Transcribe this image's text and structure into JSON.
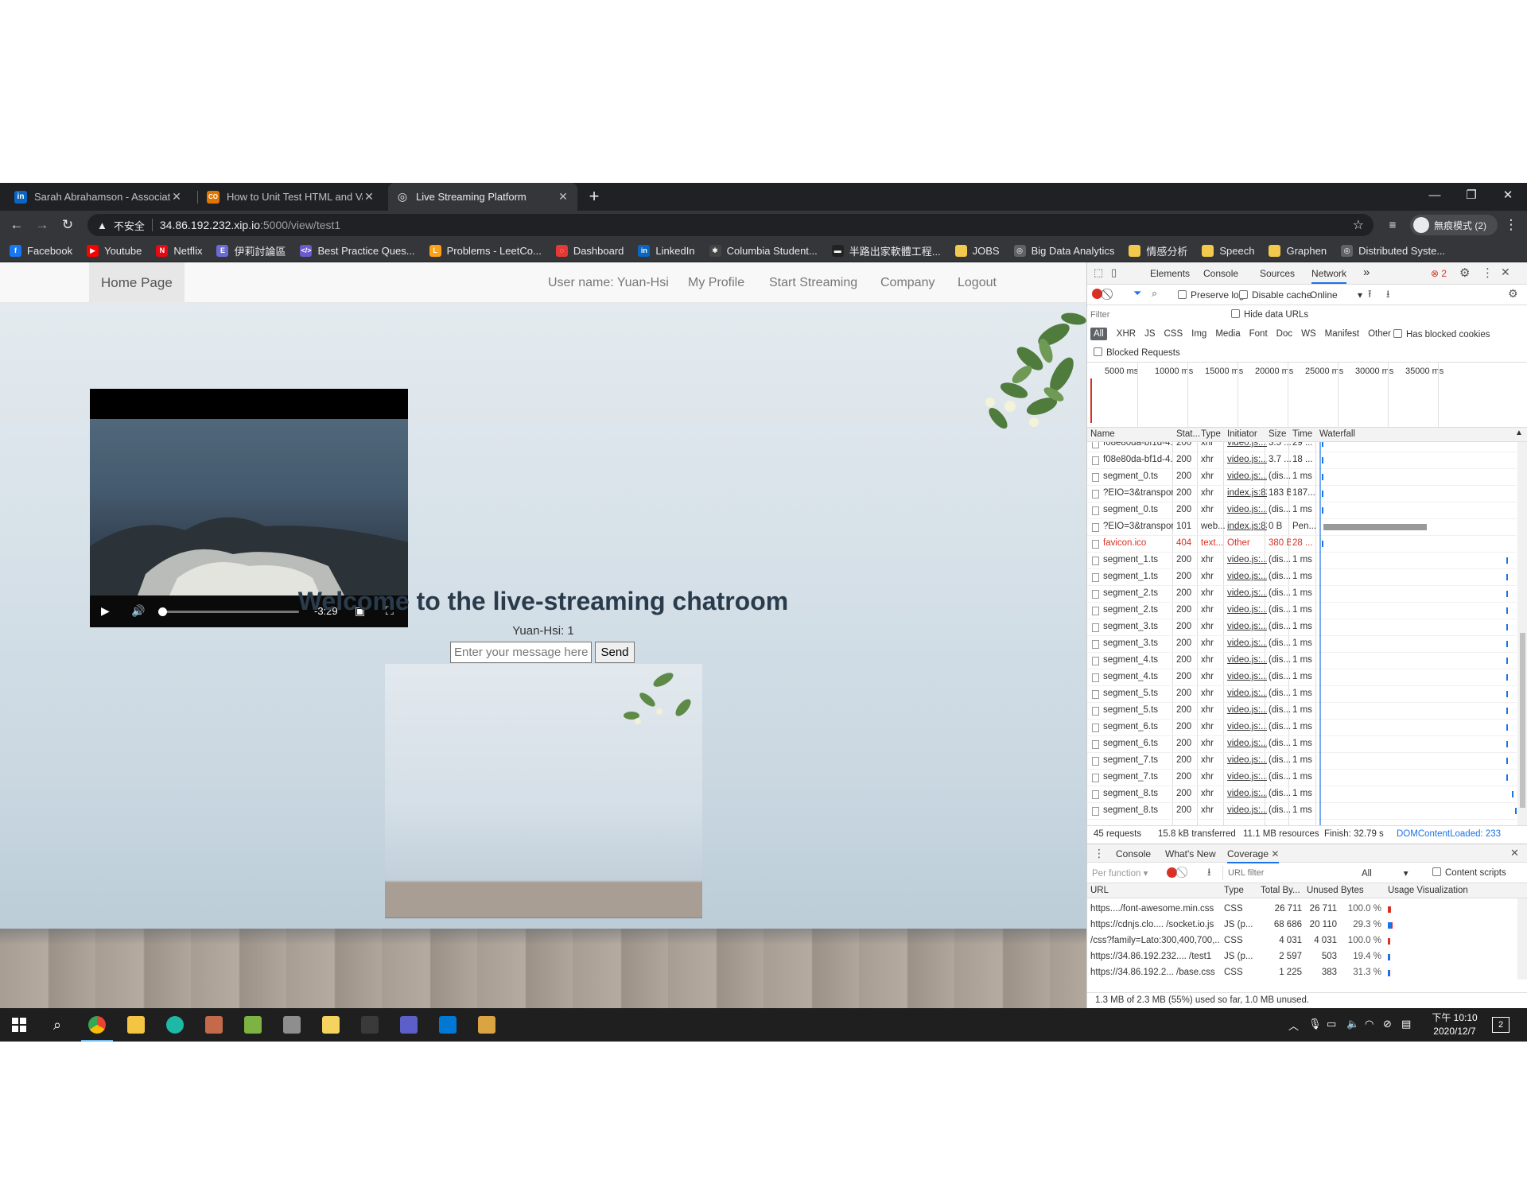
{
  "browser": {
    "tabs": [
      {
        "title": "Sarah Abrahamson - Associate",
        "icon": "linkedin-icon",
        "color": "#0a66c2",
        "glyph": "in"
      },
      {
        "title": "How to Unit Test HTML and Va",
        "icon": "colab-icon",
        "color": "#f9ab00",
        "glyph": "CO"
      },
      {
        "title": "Live Streaming Platform",
        "icon": "globe-icon",
        "color": "#5f6368",
        "glyph": "◎"
      }
    ],
    "new_tab": "+",
    "window_controls": {
      "minimize": "—",
      "maximize": "❐",
      "close": "✕"
    },
    "insecure_label": "不安全",
    "url_host": "34.86.192.232.xip.io",
    "url_path": ":5000/view/test1",
    "profile_label": "無痕模式 (2)"
  },
  "bookmarks": [
    {
      "label": "Facebook",
      "color": "#1877f2",
      "glyph": "f"
    },
    {
      "label": "Youtube",
      "color": "#ff0000",
      "glyph": "▶"
    },
    {
      "label": "Netflix",
      "color": "#e50914",
      "glyph": "N"
    },
    {
      "label": "伊莉討論區",
      "color": "#6b6bd6",
      "glyph": "E"
    },
    {
      "label": "Best Practice Ques...",
      "color": "#6a5acd",
      "glyph": "</>"
    },
    {
      "label": "Problems - LeetCo...",
      "color": "#ffa116",
      "glyph": "L"
    },
    {
      "label": "Dashboard",
      "color": "#e53935",
      "glyph": "◌"
    },
    {
      "label": "LinkedIn",
      "color": "#0a66c2",
      "glyph": "in"
    },
    {
      "label": "Columbia Student...",
      "color": "#444444",
      "glyph": "✱"
    },
    {
      "label": "半路出家軟體工程...",
      "color": "#222222",
      "glyph": "▬"
    },
    {
      "label": "JOBS",
      "color": "#f2c94c",
      "glyph": ""
    },
    {
      "label": "Big Data Analytics",
      "color": "#5f6368",
      "glyph": "◎"
    },
    {
      "label": "情感分析",
      "color": "#f2c94c",
      "glyph": ""
    },
    {
      "label": "Speech",
      "color": "#f2c94c",
      "glyph": ""
    },
    {
      "label": "Graphen",
      "color": "#f2c94c",
      "glyph": ""
    },
    {
      "label": "Distributed Syste...",
      "color": "#5f6368",
      "glyph": "◎"
    }
  ],
  "site": {
    "brand": "Home Page",
    "nav": [
      "User name: Yuan-Hsi",
      "My Profile",
      "Start Streaming",
      "Company",
      "Logout"
    ],
    "video_time": "-3:29",
    "video_progress": 0.0,
    "heading": "Welcome to the live-streaming chatroom",
    "chat_message": "Yuan-Hsi: 1",
    "input_placeholder": "Enter your message here",
    "send_label": "Send"
  },
  "devtools": {
    "tabs": [
      "Elements",
      "Console",
      "Sources",
      "Network"
    ],
    "more": "»",
    "error_count": "2",
    "preserve_log": "Preserve log",
    "disable_cache": "Disable cache",
    "throttle": "Online",
    "filter_placeholder": "Filter",
    "hide_data_urls": "Hide data URLs",
    "types": [
      "All",
      "XHR",
      "JS",
      "CSS",
      "Img",
      "Media",
      "Font",
      "Doc",
      "WS",
      "Manifest",
      "Other"
    ],
    "has_blocked_cookies": "Has blocked cookies",
    "blocked_requests": "Blocked Requests",
    "timeline": [
      "5000 ms",
      "10000 ms",
      "15000 ms",
      "20000 ms",
      "25000 ms",
      "30000 ms",
      "35000 ms"
    ],
    "columns": [
      "Name",
      "Stat...",
      "Type",
      "Initiator",
      "Size",
      "Time",
      "Waterfall"
    ],
    "rows": [
      {
        "name": "f08e80da-bf1d-4...",
        "status": "200",
        "type": "xhr",
        "initiator": "video.js:...",
        "size": "3.5 ...",
        "time": "29 ...",
        "error": false
      },
      {
        "name": "f08e80da-bf1d-4...",
        "status": "200",
        "type": "xhr",
        "initiator": "video.js:...",
        "size": "3.7 ...",
        "time": "18 ...",
        "error": false
      },
      {
        "name": "segment_0.ts",
        "status": "200",
        "type": "xhr",
        "initiator": "video.js:...",
        "size": "(dis...",
        "time": "1 ms",
        "error": false
      },
      {
        "name": "?EIO=3&transpor...",
        "status": "200",
        "type": "xhr",
        "initiator": "index.js:83",
        "size": "183 B",
        "time": "187...",
        "error": false
      },
      {
        "name": "segment_0.ts",
        "status": "200",
        "type": "xhr",
        "initiator": "video.js:...",
        "size": "(dis...",
        "time": "1 ms",
        "error": false
      },
      {
        "name": "?EIO=3&transpor...",
        "status": "101",
        "type": "web...",
        "initiator": "index.js:83",
        "size": "0 B",
        "time": "Pen...",
        "error": false
      },
      {
        "name": "favicon.ico",
        "status": "404",
        "type": "text...",
        "initiator": "Other",
        "size": "380 B",
        "time": "28 ...",
        "error": true
      },
      {
        "name": "segment_1.ts",
        "status": "200",
        "type": "xhr",
        "initiator": "video.js:...",
        "size": "(dis...",
        "time": "1 ms",
        "error": false
      },
      {
        "name": "segment_1.ts",
        "status": "200",
        "type": "xhr",
        "initiator": "video.js:...",
        "size": "(dis...",
        "time": "1 ms",
        "error": false
      },
      {
        "name": "segment_2.ts",
        "status": "200",
        "type": "xhr",
        "initiator": "video.js:...",
        "size": "(dis...",
        "time": "1 ms",
        "error": false
      },
      {
        "name": "segment_2.ts",
        "status": "200",
        "type": "xhr",
        "initiator": "video.js:...",
        "size": "(dis...",
        "time": "1 ms",
        "error": false
      },
      {
        "name": "segment_3.ts",
        "status": "200",
        "type": "xhr",
        "initiator": "video.js:...",
        "size": "(dis...",
        "time": "1 ms",
        "error": false
      },
      {
        "name": "segment_3.ts",
        "status": "200",
        "type": "xhr",
        "initiator": "video.js:...",
        "size": "(dis...",
        "time": "1 ms",
        "error": false
      },
      {
        "name": "segment_4.ts",
        "status": "200",
        "type": "xhr",
        "initiator": "video.js:...",
        "size": "(dis...",
        "time": "1 ms",
        "error": false
      },
      {
        "name": "segment_4.ts",
        "status": "200",
        "type": "xhr",
        "initiator": "video.js:...",
        "size": "(dis...",
        "time": "1 ms",
        "error": false
      },
      {
        "name": "segment_5.ts",
        "status": "200",
        "type": "xhr",
        "initiator": "video.js:...",
        "size": "(dis...",
        "time": "1 ms",
        "error": false
      },
      {
        "name": "segment_5.ts",
        "status": "200",
        "type": "xhr",
        "initiator": "video.js:...",
        "size": "(dis...",
        "time": "1 ms",
        "error": false
      },
      {
        "name": "segment_6.ts",
        "status": "200",
        "type": "xhr",
        "initiator": "video.js:...",
        "size": "(dis...",
        "time": "1 ms",
        "error": false
      },
      {
        "name": "segment_6.ts",
        "status": "200",
        "type": "xhr",
        "initiator": "video.js:...",
        "size": "(dis...",
        "time": "1 ms",
        "error": false
      },
      {
        "name": "segment_7.ts",
        "status": "200",
        "type": "xhr",
        "initiator": "video.js:...",
        "size": "(dis...",
        "time": "1 ms",
        "error": false
      },
      {
        "name": "segment_7.ts",
        "status": "200",
        "type": "xhr",
        "initiator": "video.js:...",
        "size": "(dis...",
        "time": "1 ms",
        "error": false
      },
      {
        "name": "segment_8.ts",
        "status": "200",
        "type": "xhr",
        "initiator": "video.js:...",
        "size": "(dis...",
        "time": "1 ms",
        "error": false
      },
      {
        "name": "segment_8.ts",
        "status": "200",
        "type": "xhr",
        "initiator": "video.js:...",
        "size": "(dis...",
        "time": "1 ms",
        "error": false
      }
    ],
    "summary": {
      "requests": "45 requests",
      "transferred": "15.8 kB transferred",
      "resources": "11.1 MB resources",
      "finish": "Finish: 32.79 s",
      "dcl": "DOMContentLoaded: 233"
    },
    "drawer_tabs": [
      "Console",
      "What's New",
      "Coverage"
    ],
    "coverage": {
      "mode": "Per function",
      "url_filter_placeholder": "URL filter",
      "type_filter": "All",
      "content_scripts": "Content scripts",
      "columns": [
        "URL",
        "Type",
        "Total By...",
        "Unused Bytes",
        "Usage Visualization"
      ],
      "rows": [
        {
          "url": "https..../font-awesome.min.css",
          "type": "CSS",
          "total": "26 711",
          "unused": "26 711",
          "pct": "100.0 %"
        },
        {
          "url": "https://cdnjs.clo.... /socket.io.js",
          "type": "JS (p...",
          "total": "68 686",
          "unused": "20 110",
          "pct": "29.3 %"
        },
        {
          "url": "/css?family=Lato:300,400,700,...",
          "type": "CSS",
          "total": "4 031",
          "unused": "4 031",
          "pct": "100.0 %"
        },
        {
          "url": "https://34.86.192.232.... /test1",
          "type": "JS (p...",
          "total": "2 597",
          "unused": "503",
          "pct": "19.4 %"
        },
        {
          "url": "https://34.86.192.2... /base.css",
          "type": "CSS",
          "total": "1 225",
          "unused": "383",
          "pct": "31.3 %"
        }
      ],
      "footer": "1.3 MB of 2.3 MB (55%) used so far, 1.0 MB unused."
    }
  },
  "taskbar": {
    "time": "下午 10:10",
    "date": "2020/12/7",
    "notification_count": "2",
    "apps": [
      {
        "name": "chrome",
        "color": "#4285f4"
      },
      {
        "name": "file-explorer",
        "color": "#f4c542"
      },
      {
        "name": "edge",
        "color": "#1db9a6"
      },
      {
        "name": "vscode-like",
        "color": "#c46a4b"
      },
      {
        "name": "notepad-plus",
        "color": "#7cb342"
      },
      {
        "name": "photos",
        "color": "#8e8e8e"
      },
      {
        "name": "sticky",
        "color": "#f4d35e"
      },
      {
        "name": "terminal",
        "color": "#3a3a3a"
      },
      {
        "name": "teams",
        "color": "#5b5fc7"
      },
      {
        "name": "outlook",
        "color": "#0078d4"
      },
      {
        "name": "paint",
        "color": "#d9a441"
      }
    ]
  }
}
